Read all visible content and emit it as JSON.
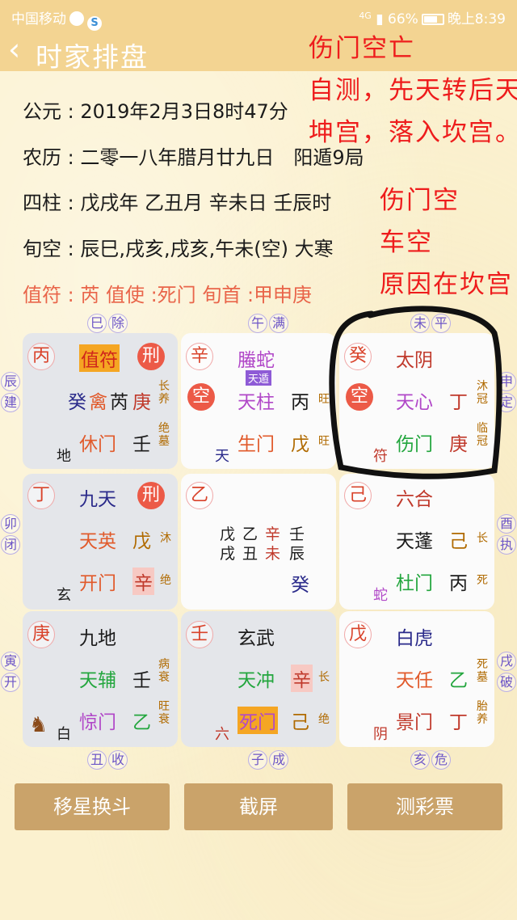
{
  "status_bar": {
    "carrier": "中国移动",
    "network": "4G",
    "battery": "66%",
    "time": "晚上8:39"
  },
  "header": {
    "title": "时家排盘"
  },
  "info": {
    "gongyuan": "公元 : 2019年2月3日8时47分",
    "nongli": "农历 : 二零一八年腊月廿九日　阳遁9局",
    "sizhu": "四柱 : 戊戌年 乙丑月 辛未日 壬辰时",
    "xunkong": "旬空 : 辰巳,戌亥,戌亥,午未(空)  大寒",
    "zhifu": "值符 : 芮  值使 :死门  旬首 :甲申庚"
  },
  "annotations": {
    "a1": "伤门空亡",
    "a2": "自测，先天转后天",
    "a3": "坤宫，落入坎宫。",
    "a4": "伤门空",
    "a5": "车空",
    "a6": "原因在坎宫"
  },
  "border": {
    "top": [
      [
        "巳",
        "除"
      ],
      [
        "午",
        "满"
      ],
      [
        "未",
        "平"
      ]
    ],
    "bottom": [
      [
        "丑",
        "收"
      ],
      [
        "子",
        "成"
      ],
      [
        "亥",
        "危"
      ]
    ],
    "left": [
      [
        "辰",
        "建"
      ],
      [
        "卯",
        "闭"
      ],
      [
        "寅",
        "开"
      ]
    ],
    "right": [
      [
        "申",
        "定"
      ],
      [
        "酉",
        "执"
      ],
      [
        "戌",
        "破"
      ]
    ]
  },
  "cells": {
    "c00": {
      "gan": "丙",
      "deity": "值符",
      "xing": "刑",
      "star_left": "癸",
      "star_mid": "禽",
      "star_right": "芮",
      "star_gan": "庚",
      "s1": "长养",
      "door": "休门",
      "door_gan": "壬",
      "s2": "绝墓",
      "god": "地"
    },
    "c01": {
      "gan": "辛",
      "deity": "螣蛇",
      "badge": "天遁",
      "kong": "空",
      "star": "天柱",
      "star_gan": "丙",
      "s1": "旺",
      "door": "生门",
      "door_gan": "戊",
      "s2": "旺",
      "god": "天"
    },
    "c02": {
      "gan": "癸",
      "deity": "太阴",
      "kong": "空",
      "star": "天心",
      "star_gan": "丁",
      "s1": "沐冠",
      "door": "伤门",
      "door_gan": "庚",
      "s2": "临冠",
      "god": "符"
    },
    "c10": {
      "gan": "丁",
      "deity": "九天",
      "xing": "刑",
      "star": "天英",
      "star_gan": "戊",
      "s1": "沐",
      "door": "开门",
      "door_gan": "辛",
      "s2": "绝",
      "god": "玄"
    },
    "c11": {
      "gan": "乙",
      "l1": [
        "戊",
        "乙",
        "辛",
        "壬"
      ],
      "l2": [
        "戌",
        "丑",
        "未",
        "辰"
      ],
      "bottom": "癸"
    },
    "c12": {
      "gan": "己",
      "deity": "六合",
      "star": "天蓬",
      "star_gan": "己",
      "s1": "长",
      "door": "杜门",
      "door_gan": "丙",
      "s2": "死",
      "god": "蛇"
    },
    "c20": {
      "gan": "庚",
      "deity": "九地",
      "star": "天辅",
      "star_gan": "壬",
      "s1": "病衰",
      "door": "惊门",
      "door_gan": "乙",
      "s2": "旺衰",
      "god": "白"
    },
    "c21": {
      "gan": "壬",
      "deity": "玄武",
      "star": "天冲",
      "star_gan": "辛",
      "s1": "长",
      "door": "死门",
      "door_gan": "己",
      "s2": "绝",
      "god": "六"
    },
    "c22": {
      "gan": "戊",
      "deity": "白虎",
      "star": "天任",
      "star_gan": "乙",
      "s1": "死墓",
      "door": "景门",
      "door_gan": "丁",
      "s2": "胎养",
      "god": "阴"
    }
  },
  "buttons": {
    "b1": "移星换斗",
    "b2": "截屏",
    "b3": "测彩票"
  },
  "colors": {
    "header_bg": "#f3d492",
    "annotation_red": "#ee1c1c",
    "button_bg": "#caa36a"
  }
}
